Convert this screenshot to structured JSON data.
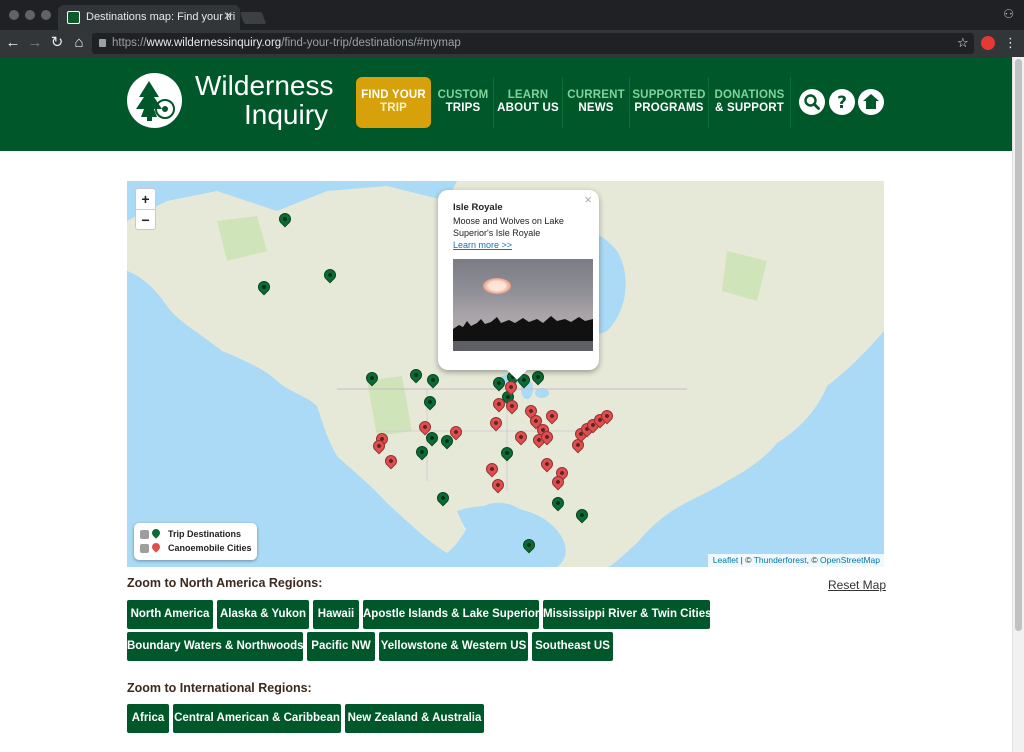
{
  "browser": {
    "tab_title": "Destinations map: Find your tri",
    "url_host": "www.wildernessinquiry.org",
    "url_scheme": "https://",
    "url_path": "/find-your-trip/destinations/#mymap"
  },
  "header": {
    "logo_line1": "Wilderness",
    "logo_line2": "Inquiry",
    "nav": [
      {
        "top": "FIND YOUR",
        "bottom": "TRIP"
      },
      {
        "top": "CUSTOM",
        "bottom": "TRIPS"
      },
      {
        "top": "LEARN",
        "bottom": "ABOUT US"
      },
      {
        "top": "CURRENT",
        "bottom": "NEWS"
      },
      {
        "top": "SUPPORTED",
        "bottom": "PROGRAMS"
      },
      {
        "top": "DONATIONS",
        "bottom": "& SUPPORT"
      }
    ],
    "icons": [
      "search-icon",
      "help-icon",
      "home-icon"
    ],
    "colors": {
      "brand_green": "#00582a",
      "accent_gold": "#d6a10b",
      "nav_light_green": "#7fd39a"
    }
  },
  "map": {
    "zoom_in": "+",
    "zoom_out": "−",
    "popup": {
      "close": "×",
      "title": "Isle Royale",
      "description": "Moose and Wolves on Lake Superior's Isle Royale",
      "link": "Learn more >>"
    },
    "legend": {
      "trip_destinations": "Trip Destinations",
      "canoemobile_cities": "Canoemobile Cities"
    },
    "attribution": {
      "leaflet": "Leaflet",
      "sep1": " | © ",
      "thunderforest": "Thunderforest",
      "sep2": ", © ",
      "osm": "OpenStreetMap"
    }
  },
  "regions": {
    "north_america_title": "Zoom to North America Regions:",
    "reset_label": "Reset Map",
    "north_america": [
      "North America",
      "Alaska & Yukon",
      "Hawaii",
      "Apostle Islands & Lake Superior",
      "Mississippi River & Twin Cities",
      "Boundary Waters & Northwoods",
      "Pacific NW",
      "Yellowstone & Western US",
      "Southeast US"
    ],
    "international_title": "Zoom to International Regions:",
    "international": [
      "Africa",
      "Central American & Caribbean",
      "New Zealand & Australia"
    ]
  }
}
